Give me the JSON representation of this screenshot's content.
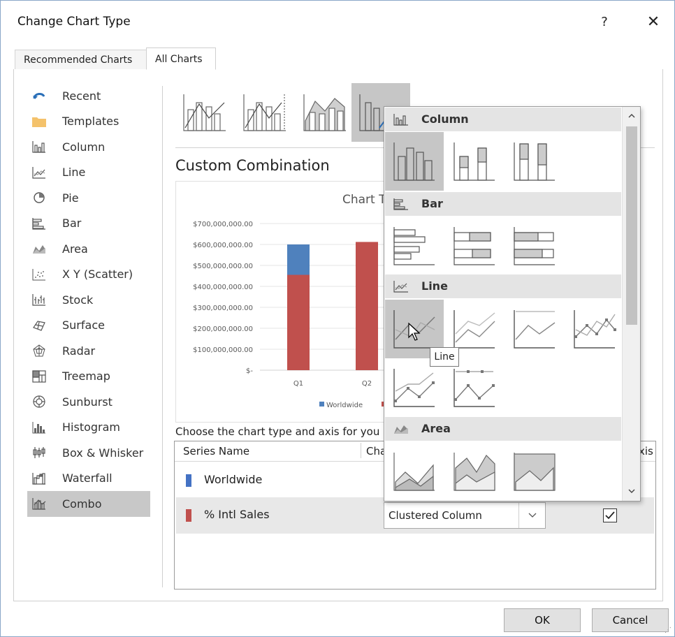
{
  "dialog": {
    "title": "Change Chart Type",
    "help": "?",
    "close": "✕"
  },
  "tabs": [
    {
      "label": "Recommended Charts"
    },
    {
      "label": "All Charts"
    }
  ],
  "sidebar": {
    "items": [
      {
        "label": "Recent",
        "icon": "recent-icon"
      },
      {
        "label": "Templates",
        "icon": "folder-icon"
      },
      {
        "label": "Column",
        "icon": "column-chart-icon"
      },
      {
        "label": "Line",
        "icon": "line-chart-icon"
      },
      {
        "label": "Pie",
        "icon": "pie-chart-icon"
      },
      {
        "label": "Bar",
        "icon": "bar-chart-icon"
      },
      {
        "label": "Area",
        "icon": "area-chart-icon"
      },
      {
        "label": "X Y (Scatter)",
        "icon": "scatter-chart-icon"
      },
      {
        "label": "Stock",
        "icon": "stock-chart-icon"
      },
      {
        "label": "Surface",
        "icon": "surface-chart-icon"
      },
      {
        "label": "Radar",
        "icon": "radar-chart-icon"
      },
      {
        "label": "Treemap",
        "icon": "treemap-chart-icon"
      },
      {
        "label": "Sunburst",
        "icon": "sunburst-chart-icon"
      },
      {
        "label": "Histogram",
        "icon": "histogram-chart-icon"
      },
      {
        "label": "Box & Whisker",
        "icon": "box-whisker-chart-icon"
      },
      {
        "label": "Waterfall",
        "icon": "waterfall-chart-icon"
      },
      {
        "label": "Combo",
        "icon": "combo-chart-icon",
        "selected": true
      }
    ]
  },
  "main": {
    "section_title": "Custom Combination",
    "chart_title": "Chart T",
    "choose_text": "Choose the chart type and axis for you"
  },
  "chart_data": {
    "type": "bar",
    "title": "Chart T",
    "categories": [
      "Q1",
      "Q2"
    ],
    "series": [
      {
        "name": "Worldwide",
        "color": "#4f81bd",
        "values": [
          145000000,
          0
        ]
      },
      {
        "name": "",
        "color": "#c0504d",
        "values": [
          455000000,
          612000000
        ]
      }
    ],
    "stacked": true,
    "ylim": [
      0,
      700000000
    ],
    "yticks": [
      "$700,000,000.00",
      "$600,000,000.00",
      "$500,000,000.00",
      "$400,000,000.00",
      "$300,000,000.00",
      "$200,000,000.00",
      "$100,000,000.00",
      "$-"
    ],
    "legend": [
      "Worldwide"
    ]
  },
  "series_table": {
    "headers": {
      "name": "Series Name",
      "type": "Cha",
      "axis": "xis"
    },
    "rows": [
      {
        "name": "Worldwide",
        "color": "#4472c4"
      },
      {
        "name": "% Intl Sales",
        "color": "#c0504d",
        "chart_type": "Clustered Column",
        "secondary_axis": true
      }
    ]
  },
  "flyout": {
    "sections": [
      {
        "label": "Column",
        "icon": "column-chart-icon"
      },
      {
        "label": "Bar",
        "icon": "bar-chart-icon"
      },
      {
        "label": "Line",
        "icon": "line-chart-icon"
      },
      {
        "label": "Area",
        "icon": "area-chart-icon"
      }
    ],
    "tooltip": "Line"
  },
  "buttons": {
    "ok": "OK",
    "cancel": "Cancel"
  }
}
